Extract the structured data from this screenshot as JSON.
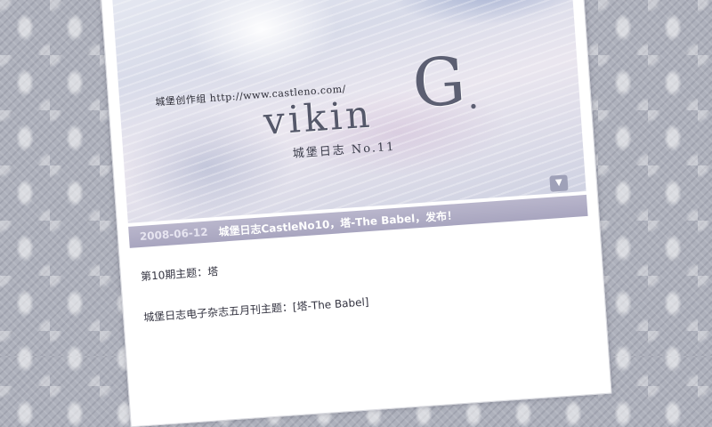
{
  "banner": {
    "url_text": "城堡创作组 http://www.castleno.com/",
    "logo_text": "vikin",
    "logo_big_letter": "G",
    "logo_dot": ".",
    "subtitle": "城堡日志 No.11"
  },
  "collapse_icon": "chevron-double-down-icon",
  "post": {
    "date": "2008-06-12",
    "title": "城堡日志CastleNo10，塔-The Babel，发布！",
    "lines": [
      "第10期主题：塔",
      "城堡日志电子杂志五月刊主题：[塔-The Babel]"
    ]
  },
  "colors": {
    "title_bar": "#aaa7c1",
    "page_background": "#aeb1bc"
  }
}
